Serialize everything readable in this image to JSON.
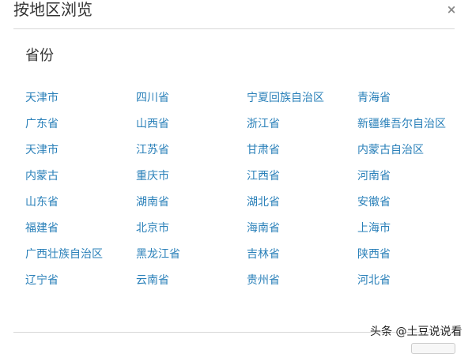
{
  "dialog": {
    "title": "按地区浏览",
    "close_label": "×"
  },
  "section": {
    "title": "省份"
  },
  "provinces": [
    "天津市",
    "四川省",
    "宁夏回族自治区",
    "青海省",
    "广东省",
    "山西省",
    "浙江省",
    "新疆维吾尔自治区",
    "天津市",
    "江苏省",
    "甘肃省",
    "内蒙古自治区",
    "内蒙古",
    "重庆市",
    "江西省",
    "河南省",
    "山东省",
    "湖南省",
    "湖北省",
    "安徽省",
    "福建省",
    "北京市",
    "海南省",
    "上海市",
    "广西壮族自治区",
    "黑龙江省",
    "吉林省",
    "陕西省",
    "辽宁省",
    "云南省",
    "贵州省",
    "河北省"
  ],
  "watermark": "头条 @土豆说说看",
  "colors": {
    "link": "#2a80b9",
    "title": "#333333",
    "divider": "#d8d8d8"
  }
}
